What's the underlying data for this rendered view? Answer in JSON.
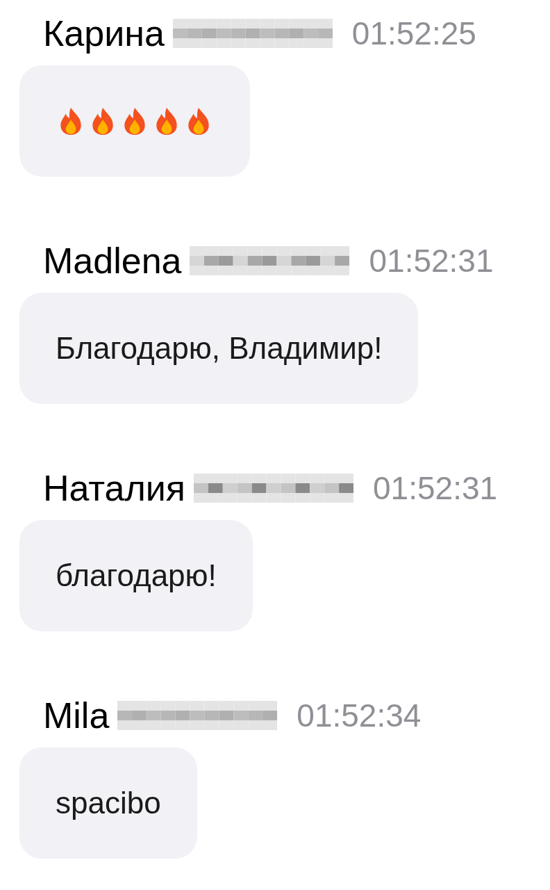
{
  "messages": [
    {
      "author": "Карина",
      "surname_redacted": true,
      "time": "01:52:25",
      "kind": "emoji",
      "emojis": [
        {
          "kind": "fire"
        },
        {
          "kind": "fire"
        },
        {
          "kind": "fire"
        },
        {
          "kind": "fire"
        },
        {
          "kind": "fire"
        }
      ]
    },
    {
      "author": "Madlena",
      "surname_redacted": true,
      "time": "01:52:31",
      "kind": "text",
      "text": "Благодарю, Владимир!"
    },
    {
      "author": "Наталия",
      "surname_redacted": true,
      "time": "01:52:31",
      "kind": "text",
      "text": "благодарю!"
    },
    {
      "author": "Mila",
      "surname_redacted": true,
      "time": "01:52:34",
      "kind": "text",
      "text": "spacibo"
    }
  ]
}
